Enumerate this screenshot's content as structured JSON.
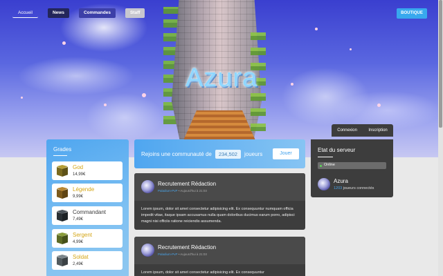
{
  "nav": {
    "items": [
      {
        "label": "Accueil"
      },
      {
        "label": "News"
      },
      {
        "label": "Commandes"
      },
      {
        "label": "Staff"
      }
    ],
    "shop_label": "BOUTIQUE"
  },
  "hero": {
    "title": "Azura"
  },
  "auth": {
    "login_label": "Connexion",
    "register_label": "Inscription"
  },
  "grades": {
    "title": "Grades",
    "items": [
      {
        "name": "God",
        "price": "14,99€",
        "color": "#d4a514"
      },
      {
        "name": "Légende",
        "price": "9,99€",
        "color": "#d4a514"
      },
      {
        "name": "Commandant",
        "price": "7,49€",
        "color": "#3a3a3a"
      },
      {
        "name": "Sergent",
        "price": "4,99€",
        "color": "#d4a514"
      },
      {
        "name": "Soldat",
        "price": "2,49€",
        "color": "#d4a514"
      }
    ]
  },
  "community": {
    "text_before": "Rejoins une communauté de",
    "count": "234,502",
    "text_after": "joueurs",
    "join_label": "Jouer"
  },
  "posts": [
    {
      "title": "Recrutement Rédaction",
      "author": "Paladium-PvP",
      "date": "Aujourd'hui à 21:03",
      "body": "Lorem ipsum, dolor sit amet consectetur adipisicing elit. Ex consequuntur numquam officia impedit vitae, itaque ipsam accusamus nulla quam doloribus ducimus earum porro, adipisci magni nisi officiis ratione reiciendis assumenda."
    },
    {
      "title": "Recrutement Rédaction",
      "author": "Paladium-PvP",
      "date": "Aujourd'hui à 21:03",
      "body": "Lorem ipsum, dolor sit amet consectetur adipisicing elit. Ex consequuntur"
    }
  ],
  "server": {
    "title": "Etat du serveur",
    "status": "Online",
    "name": "Azura",
    "players_count": "1203",
    "players_label": "joueurs connectés"
  }
}
